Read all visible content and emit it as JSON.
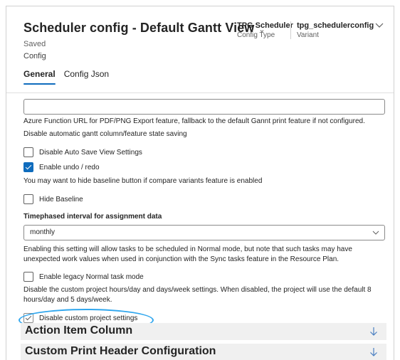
{
  "header": {
    "title": "Scheduler config - Default Gantt View",
    "saved_status": "Saved",
    "entity_name": "Config",
    "meta": [
      {
        "value": "TPG Scheduler",
        "label": "Config Type"
      },
      {
        "value": "tpg_schedulerconfig",
        "label": "Variant"
      }
    ],
    "tabs": [
      {
        "label": "General",
        "active": true
      },
      {
        "label": "Config Json",
        "active": false
      }
    ]
  },
  "form": {
    "export_url_input_value": "",
    "export_url_help": "Azure Function URL for PDF/PNG Export feature, fallback to the default Gannt print feature if not configured.",
    "auto_save_note": "Disable automatic gantt column/feature state saving",
    "disable_auto_save": {
      "label": "Disable Auto Save View Settings",
      "checked": false
    },
    "enable_undo": {
      "label": "Enable undo / redo",
      "checked": true
    },
    "baseline_note": "You may want to hide baseline button if compare variants feature is enabled",
    "hide_baseline": {
      "label": "Hide Baseline",
      "checked": false
    },
    "timephased_label": "Timephased interval for assignment data",
    "timephased_value": "monthly",
    "normal_mode_note": "Enabling this setting will allow tasks to be scheduled in Normal mode, but note that such tasks may have unexpected work values when used in conjunction with the Sync tasks feature in the Resource Plan.",
    "legacy_normal": {
      "label": "Enable legacy Normal task mode",
      "checked": false
    },
    "custom_settings_note": "Disable the custom project hours/day and days/week settings. When disabled, the project will use the default 8 hours/day and 5 days/week.",
    "disable_custom": {
      "label": "Disable custom project settings",
      "checked": true
    }
  },
  "sections": [
    {
      "label": "Action Item Column"
    },
    {
      "label": "Custom Print Header Configuration"
    }
  ],
  "colors": {
    "accent": "#0f6cbd",
    "highlight_ring": "#31a7ee",
    "section_bg": "#f0f0f0"
  },
  "icons": {
    "title_dropdown": "chevron-down-icon",
    "header_expand": "chevron-down-icon",
    "select_dropdown": "chevron-down-icon",
    "section_expand": "arrow-down-icon"
  }
}
